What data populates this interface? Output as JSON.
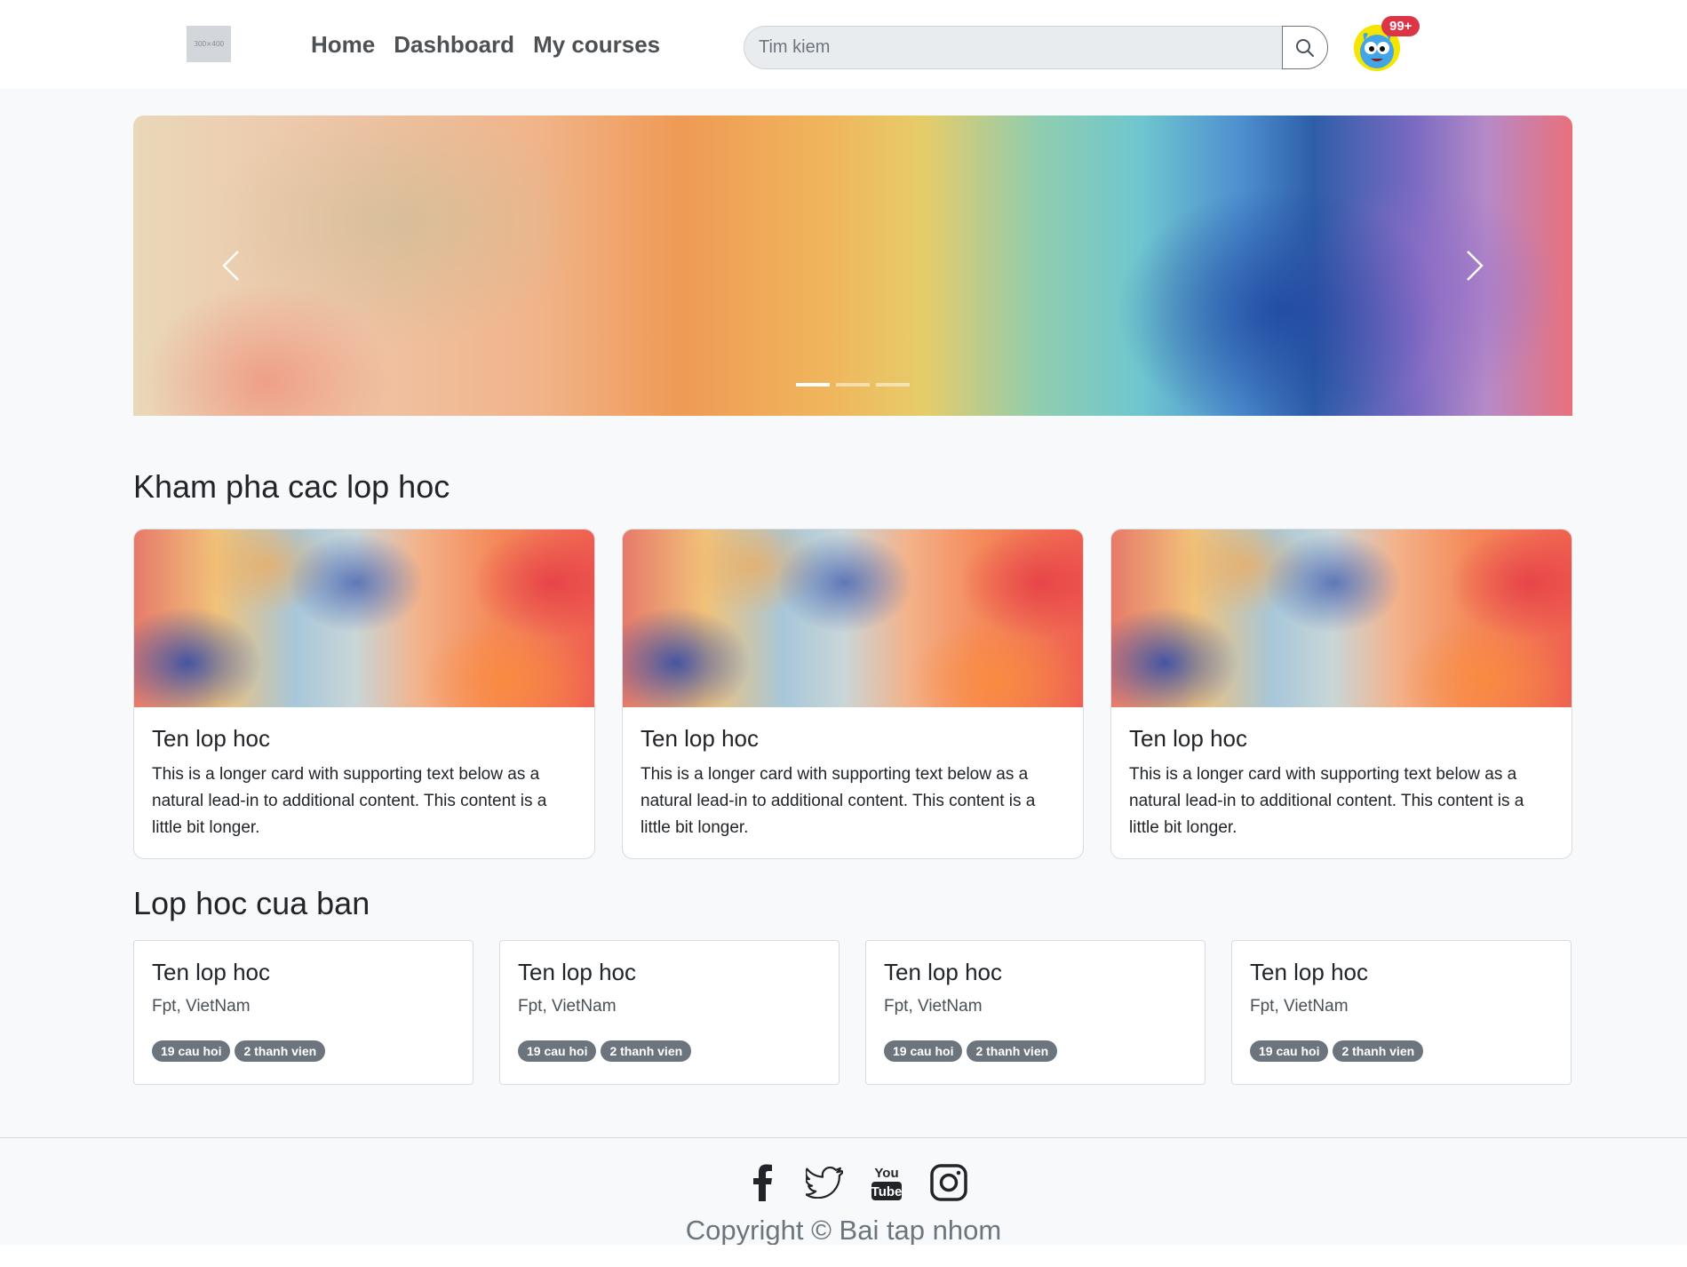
{
  "navbar": {
    "logo_text": "300×400",
    "links": [
      "Home",
      "Dashboard",
      "My courses"
    ],
    "search_placeholder": "Tim kiem",
    "notification_badge": "99+"
  },
  "carousel": {
    "slide_count": 3,
    "active_index": 0
  },
  "explore": {
    "title": "Kham pha cac lop hoc",
    "cards": [
      {
        "title": "Ten lop hoc",
        "text": "This is a longer card with supporting text below as a natural lead-in to additional content. This content is a little bit longer."
      },
      {
        "title": "Ten lop hoc",
        "text": "This is a longer card with supporting text below as a natural lead-in to additional content. This content is a little bit longer."
      },
      {
        "title": "Ten lop hoc",
        "text": "This is a longer card with supporting text below as a natural lead-in to additional content. This content is a little bit longer."
      }
    ]
  },
  "mine": {
    "title": "Lop hoc cua ban",
    "cards": [
      {
        "title": "Ten lop hoc",
        "subtitle": "Fpt, VietNam",
        "questions": "19 cau hoi",
        "members": "2 thanh vien"
      },
      {
        "title": "Ten lop hoc",
        "subtitle": "Fpt, VietNam",
        "questions": "19 cau hoi",
        "members": "2 thanh vien"
      },
      {
        "title": "Ten lop hoc",
        "subtitle": "Fpt, VietNam",
        "questions": "19 cau hoi",
        "members": "2 thanh vien"
      },
      {
        "title": "Ten lop hoc",
        "subtitle": "Fpt, VietNam",
        "questions": "19 cau hoi",
        "members": "2 thanh vien"
      }
    ]
  },
  "footer": {
    "social_icons": [
      "facebook-icon",
      "twitter-icon",
      "youtube-icon",
      "instagram-icon"
    ],
    "copyright": "Copyright © Bai tap nhom"
  },
  "colors": {
    "badge_red": "#dc3545",
    "badge_gray": "#6c757d",
    "page_bg": "#f8f9fa"
  }
}
